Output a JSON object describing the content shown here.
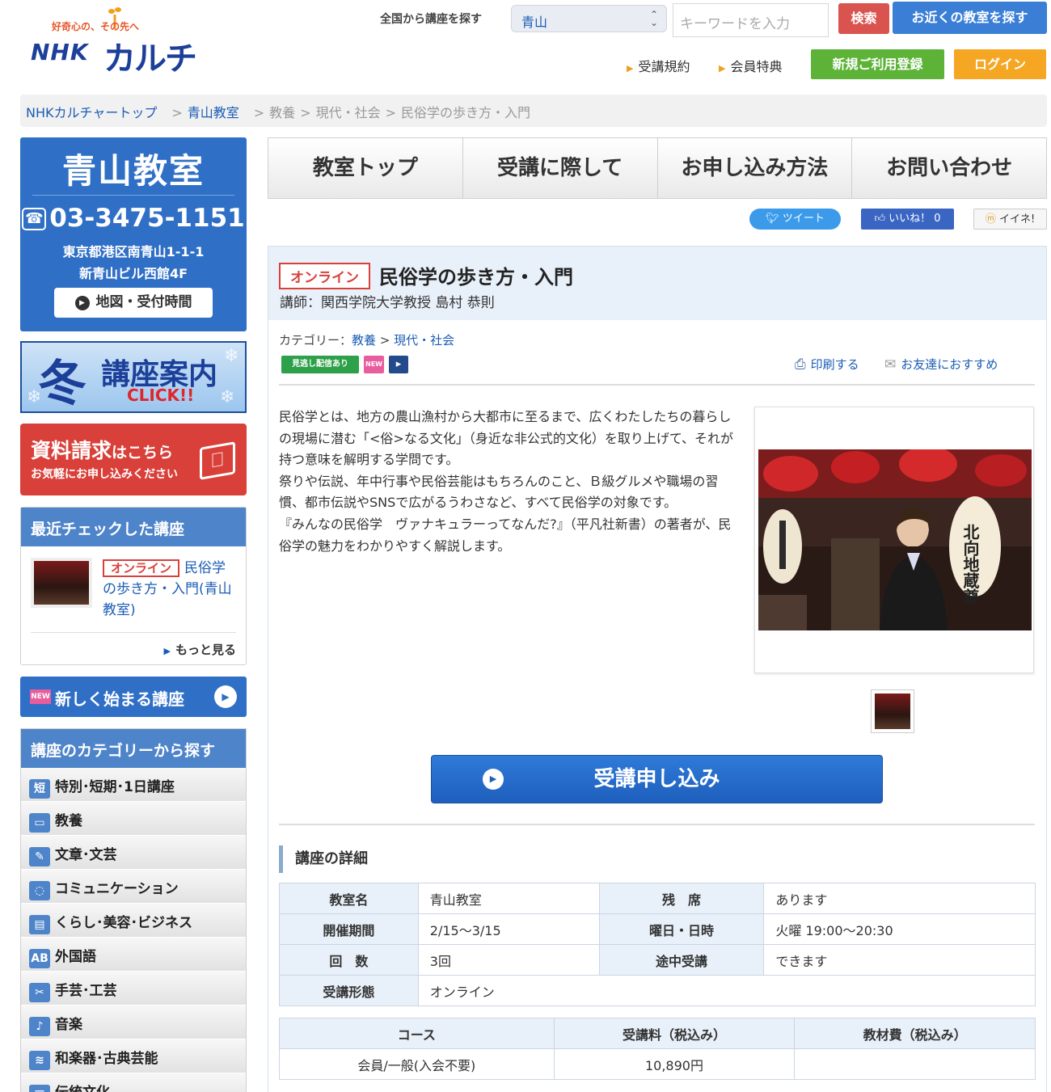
{
  "header": {
    "logo_tagline": "好奇心の、その先へ",
    "logo_nhk": "NHK",
    "logo_culture": "カルチャー",
    "search_label": "全国から講座を探す",
    "area_selected": "青山",
    "keyword_placeholder": "キーワードを入力",
    "search_button": "検索",
    "nearby_button": "お近くの教室を探す",
    "terms_link": "受講規約",
    "member_link": "会員特典",
    "register_button": "新規ご利用登録",
    "login_button": "ログイン"
  },
  "breadcrumb": {
    "top": "NHKカルチャートップ",
    "school": "青山教室",
    "cat1": "教養",
    "cat2": "現代・社会",
    "current": "民俗学の歩き方・入門"
  },
  "sidebar": {
    "school_name": "青山教室",
    "tel": "03-3475-1151",
    "address1": "東京都港区南青山1-1-1",
    "address2": "新青山ビル西館4F",
    "map_button": "地図・受付時間",
    "winter_kanji": "冬",
    "winter_guide": "講座案内",
    "winter_click": "CLICK!!",
    "doc_request": "資料請求",
    "doc_request_suffix": "はこちら",
    "doc_request_sub": "お気軽にお申し込みください",
    "recent_title": "最近チェックした講座",
    "recent_tag": "オンライン",
    "recent_course": "民俗学の歩き方・入門(青山教室)",
    "recent_more": "もっと見る",
    "new_badge": "NEW",
    "new_courses": "新しく始まる講座",
    "category_title": "講座のカテゴリーから探す",
    "categories": [
      {
        "icon": "短",
        "label": "特別･短期･1日講座"
      },
      {
        "icon": "▭",
        "label": "教養"
      },
      {
        "icon": "✎",
        "label": "文章･文芸"
      },
      {
        "icon": "◌",
        "label": "コミュニケーション"
      },
      {
        "icon": "▤",
        "label": "くらし･美容･ビジネス"
      },
      {
        "icon": "AB",
        "label": "外国語"
      },
      {
        "icon": "✂",
        "label": "手芸･工芸"
      },
      {
        "icon": "♪",
        "label": "音楽"
      },
      {
        "icon": "≋",
        "label": "和楽器･古典芸能"
      },
      {
        "icon": "▦",
        "label": "伝統文化"
      }
    ]
  },
  "tabs": [
    "教室トップ",
    "受講に際して",
    "お申し込み方法",
    "お問い合わせ"
  ],
  "share": {
    "tweet": "ツイート",
    "like": "いいね！ 0",
    "iine": "イイネ!"
  },
  "course": {
    "tag": "オンライン",
    "title": "民俗学の歩き方・入門",
    "teacher": "講師：関西学院大学教授 島村 恭則",
    "category_label": "カテゴリー：",
    "category1": "教養",
    "category2": "現代・社会",
    "badge_replay": "見逃し配信あり",
    "badge_new": "NEW",
    "print": "印刷する",
    "recommend": "お友達におすすめ",
    "description": [
      "民俗学とは、地方の農山漁村から大都市に至るまで、広くわたしたちの暮らしの現場に潜む「<俗>なる文化」（身近な非公式的文化）を取り上げて、それが持つ意味を解明する学問です。",
      "祭りや伝説、年中行事や民俗芸能はもちろんのこと、Ｂ級グルメや職場の習慣、都市伝説やSNSで広がるうわさなど、すべて民俗学の対象です。",
      "『みんなの民俗学　ヴァナキュラーってなんだ?』（平凡社新書）の著者が、民俗学の魅力をわかりやすく解説します。"
    ],
    "photo_lantern_text": "北向地蔵尊",
    "apply_button": "受講申し込み"
  },
  "details": {
    "title": "講座の詳細",
    "rows": [
      {
        "k1": "教室名",
        "v1": "青山教室",
        "k2": "残　席",
        "v2": "あります"
      },
      {
        "k1": "開催期間",
        "v1": "2/15〜3/15",
        "k2": "曜日・日時",
        "v2": "火曜 19:00〜20:30"
      },
      {
        "k1": "回　数",
        "v1": "3回",
        "k2": "途中受講",
        "v2": "できます"
      }
    ],
    "format_key": "受講形態",
    "format_value": "オンライン"
  },
  "fees": {
    "headers": [
      "コース",
      "受講料（税込み）",
      "教材費（税込み）"
    ],
    "row": [
      "会員/一般(入会不要)",
      "10,890円",
      ""
    ]
  }
}
